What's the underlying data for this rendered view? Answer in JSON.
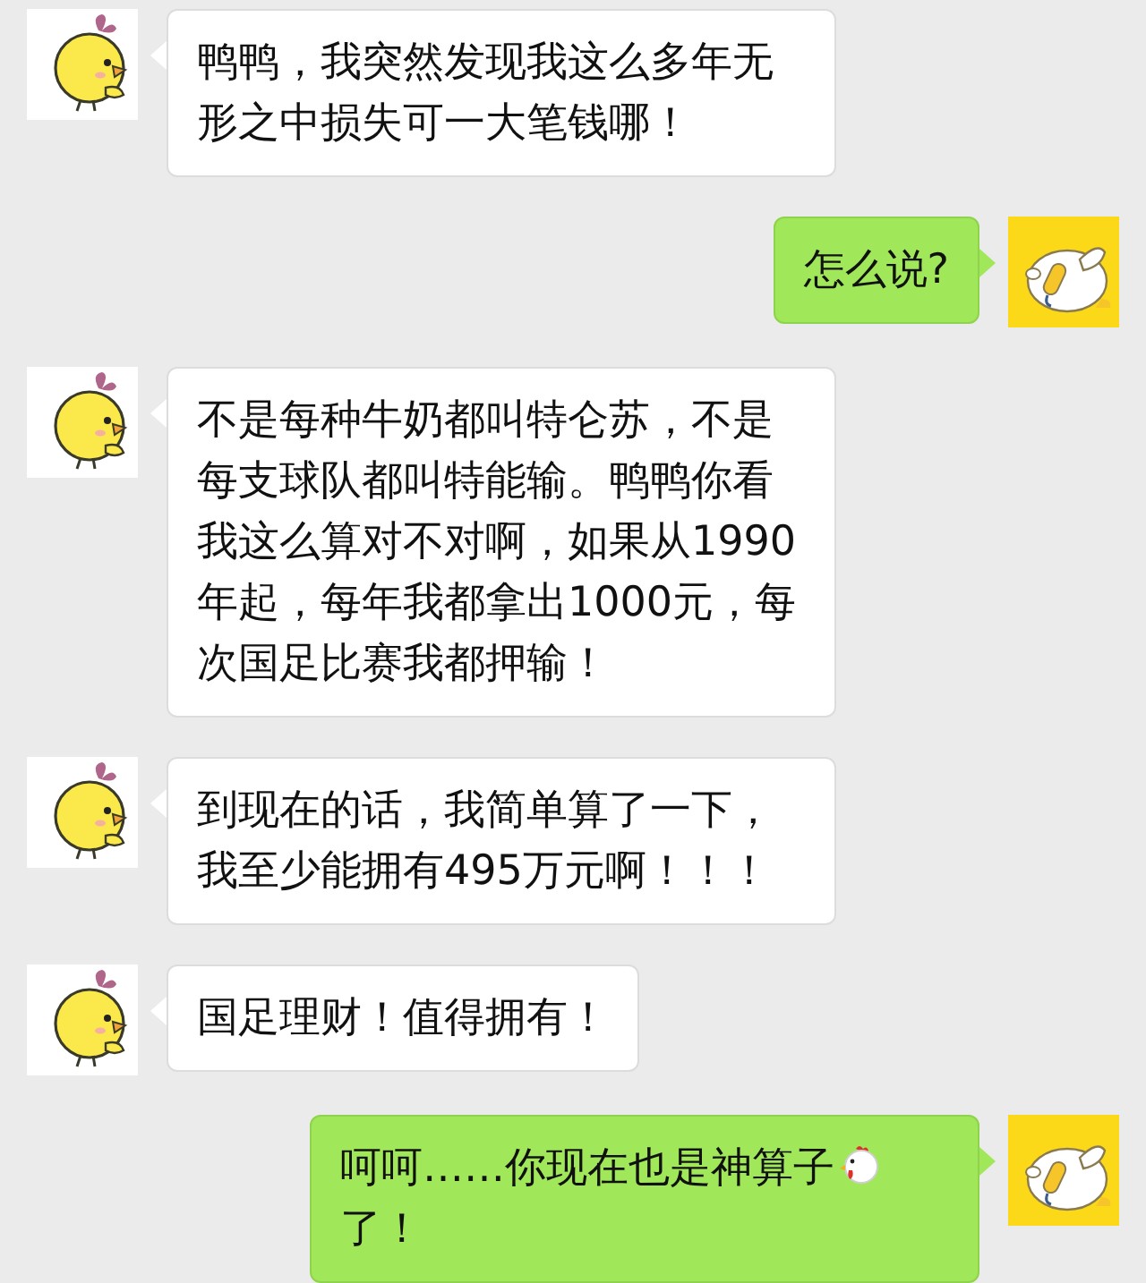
{
  "messages": [
    {
      "kind": "received",
      "parts": [
        {
          "kind": "text",
          "text": "鸭鸭，我突然发现我这么多年无形之中损失可一大笔钱哪！"
        }
      ]
    },
    {
      "kind": "sent",
      "parts": [
        {
          "kind": "text",
          "text": "怎么说?"
        }
      ]
    },
    {
      "kind": "received",
      "parts": [
        {
          "kind": "text",
          "text": "不是每种牛奶都叫特仑苏，不是每支球队都叫特能输。鸭鸭你看我这么算对不对啊，如果从1990年起，每年我都拿出1000元，每次国足比赛我都押输！"
        }
      ]
    },
    {
      "kind": "received",
      "parts": [
        {
          "kind": "text",
          "text": "到现在的话，我简单算了一下，我至少能拥有495万元啊！！！"
        }
      ]
    },
    {
      "kind": "received",
      "parts": [
        {
          "kind": "text",
          "text": "国足理财！值得拥有！"
        }
      ]
    },
    {
      "kind": "sent",
      "parts": [
        {
          "kind": "text",
          "text": "呵呵……你现在也是神算子"
        },
        {
          "kind": "chicken"
        },
        {
          "kind": "text",
          "text": "了！"
        }
      ]
    }
  ]
}
